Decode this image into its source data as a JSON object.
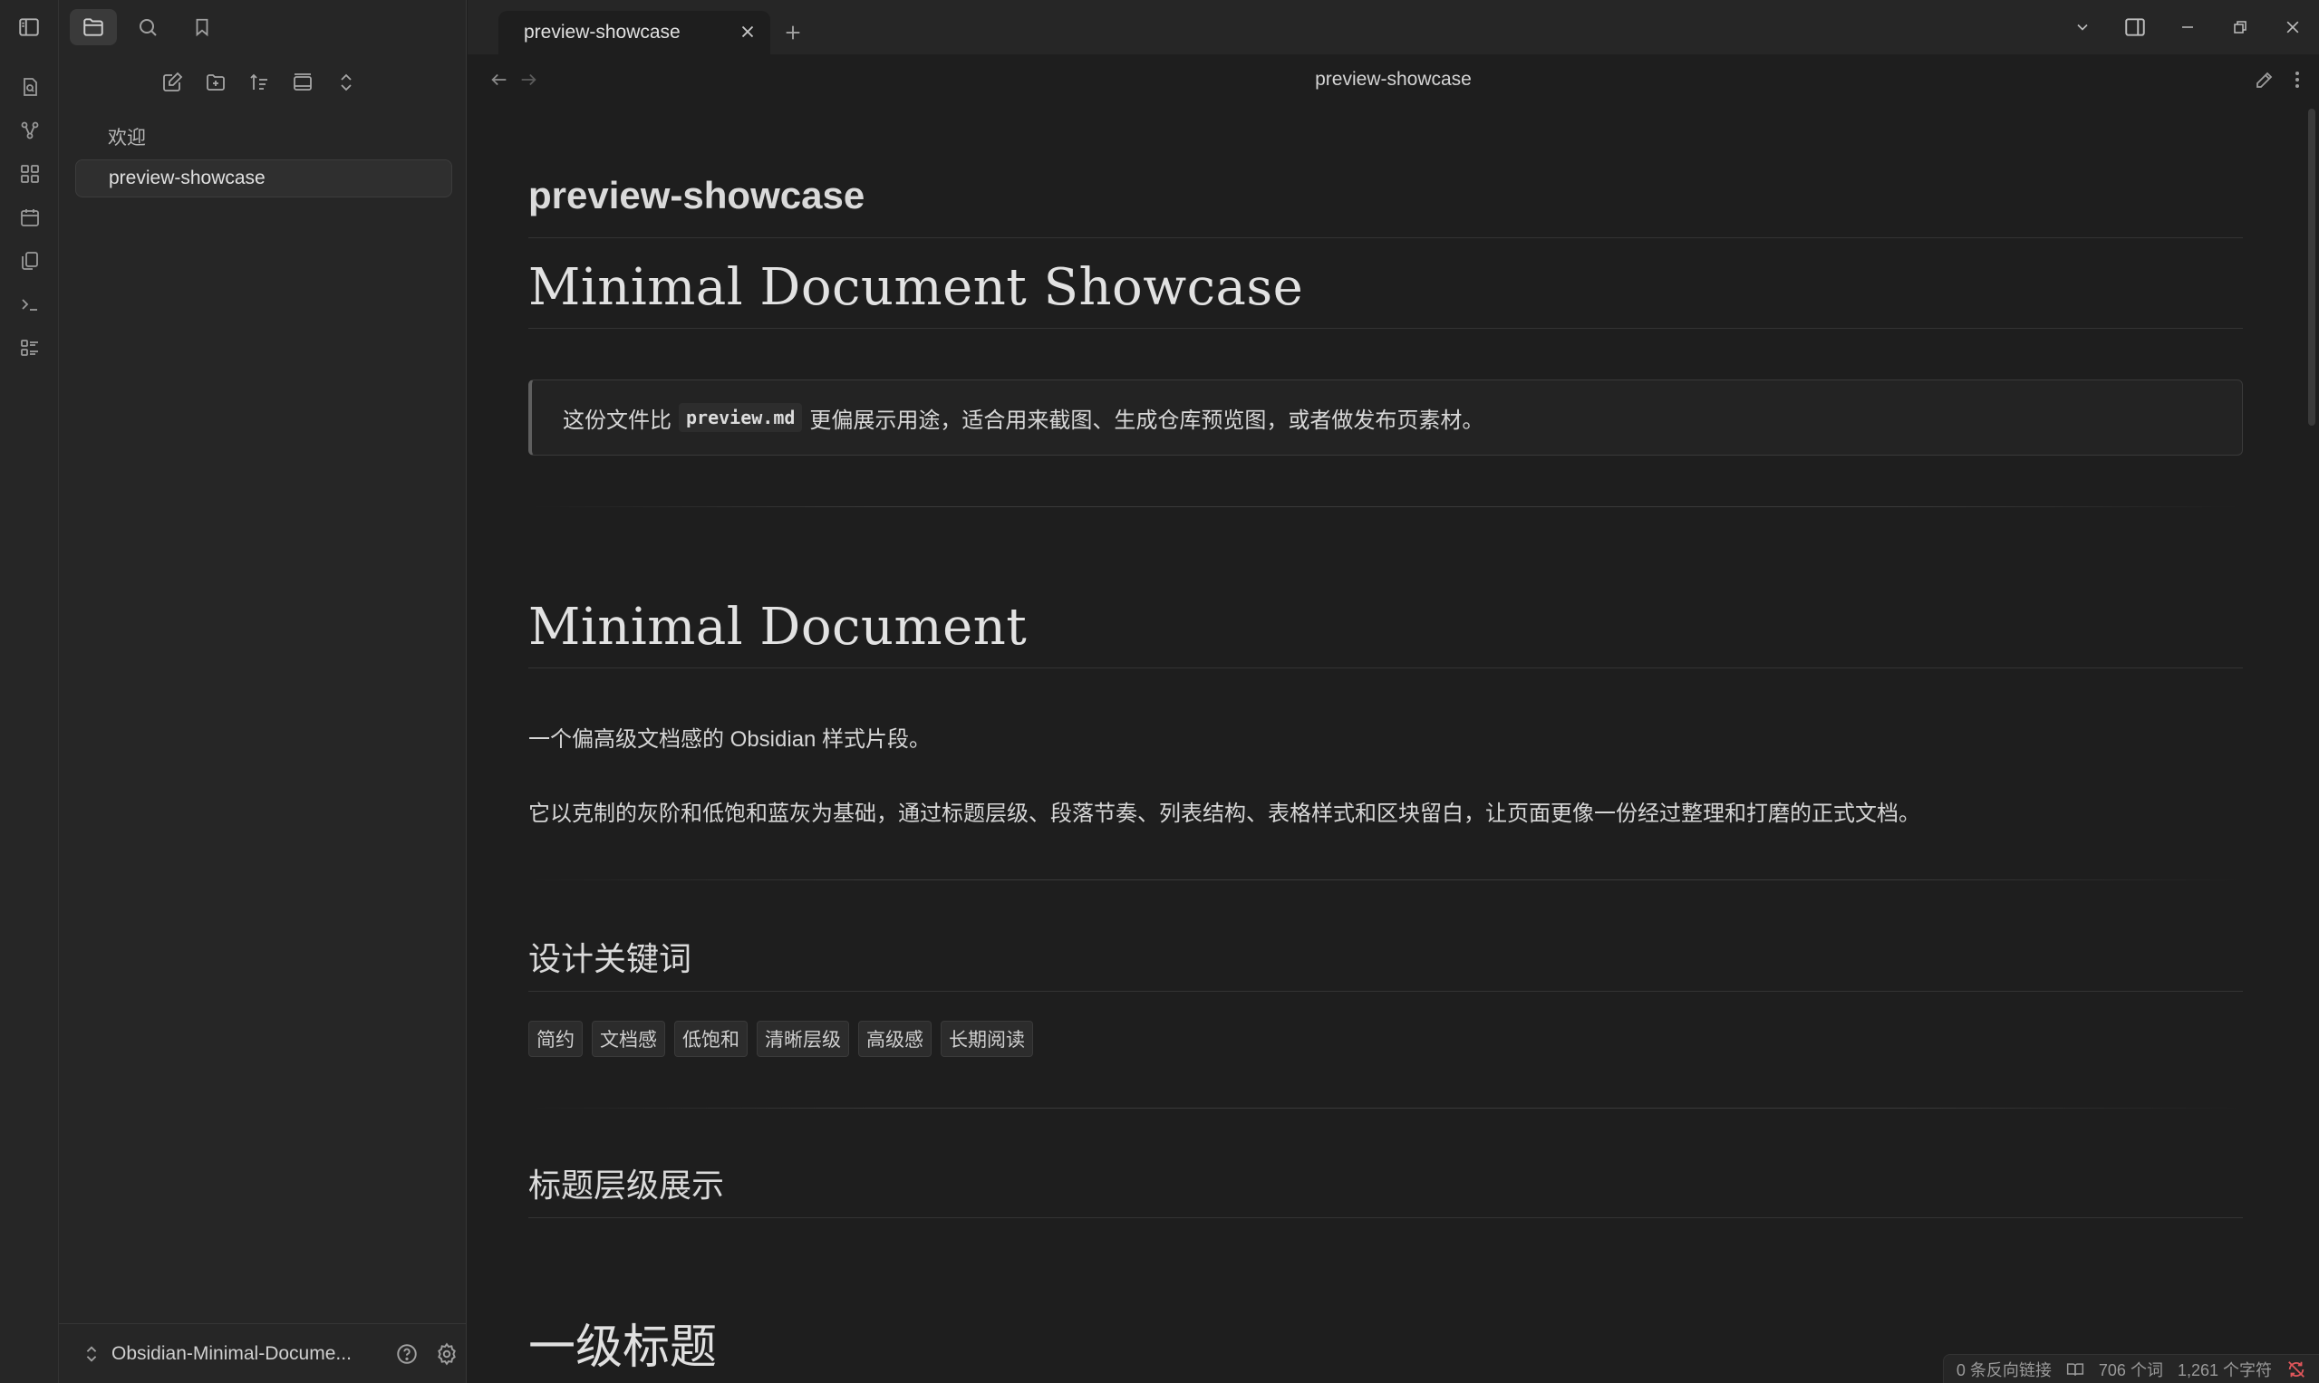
{
  "sidebar": {
    "items": [
      {
        "label": "欢迎",
        "active": false
      },
      {
        "label": "preview-showcase",
        "active": true
      }
    ],
    "vault_name": "Obsidian-Minimal-Docume..."
  },
  "tabs": [
    {
      "label": "preview-showcase",
      "active": true
    }
  ],
  "view": {
    "title": "preview-showcase"
  },
  "note": {
    "inline_title": "preview-showcase",
    "h1": "Minimal Document Showcase",
    "callout": {
      "before": "这份文件比",
      "code": "preview.md",
      "after": "更偏展示用途，适合用来截图、生成仓库预览图，或者做发布页素材。"
    },
    "section_title": "Minimal Document",
    "paragraph_1": "一个偏高级文档感的 Obsidian 样式片段。",
    "paragraph_2": "它以克制的灰阶和低饱和蓝灰为基础，通过标题层级、段落节奏、列表结构、表格样式和区块留白，让页面更像一份经过整理和打磨的正式文档。",
    "keywords_heading": "设计关键词",
    "keywords": [
      "简约",
      "文档感",
      "低饱和",
      "清晰层级",
      "高级感",
      "长期阅读"
    ],
    "levels_heading": "标题层级展示",
    "level1_heading": "一级标题"
  },
  "status": {
    "backlinks": "0 条反向链接",
    "words": "706 个词",
    "chars": "1,261 个字符"
  },
  "colors": {
    "background": "#1e1e1e",
    "sidebar": "#262626",
    "text": "#dcddde",
    "sync_error": "#e0565b"
  }
}
